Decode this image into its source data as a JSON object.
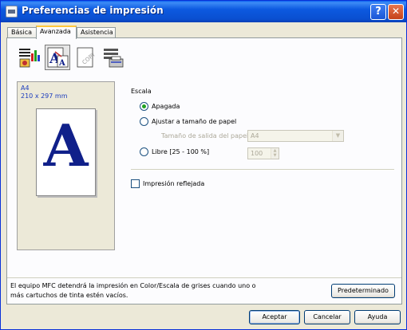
{
  "window": {
    "title": "Preferencias de impresión"
  },
  "tabs": [
    {
      "label": "Básica",
      "active": false
    },
    {
      "label": "Avanzada",
      "active": true
    },
    {
      "label": "Asistencia",
      "active": false
    }
  ],
  "toolbar_icons": [
    {
      "name": "quality-icon",
      "selected": false
    },
    {
      "name": "scaling-icon",
      "selected": true
    },
    {
      "name": "watermark-copy-icon",
      "selected": false
    },
    {
      "name": "device-options-icon",
      "selected": false
    }
  ],
  "preview": {
    "paper_size": "A4",
    "paper_dimensions": "210 x 297 mm",
    "letter": "A"
  },
  "scaling": {
    "heading": "Escala",
    "options": [
      {
        "label": "Apagada",
        "selected": true
      },
      {
        "label": "Ajustar a tamaño de papel",
        "selected": false
      },
      {
        "label": "Libre [25 - 100 %]",
        "selected": false
      }
    ],
    "output_size_label": "Tamaño de salida del papel",
    "output_size_value": "A4",
    "free_value": "100"
  },
  "mirror": {
    "label": "Impresión reflejada",
    "checked": false
  },
  "info": {
    "text": "El equipo MFC detendrá la impresión en Color/Escala de grises cuando uno o más cartuchos de tinta estén vacíos.",
    "default_button": "Predeterminado"
  },
  "footer": {
    "ok": "Aceptar",
    "cancel": "Cancelar",
    "help": "Ayuda"
  },
  "colors": {
    "titlebar": "#0a4fd0",
    "tab_accent": "#ffc73c",
    "radio_dot": "#21a121",
    "preview_text": "#1b3bbd"
  }
}
